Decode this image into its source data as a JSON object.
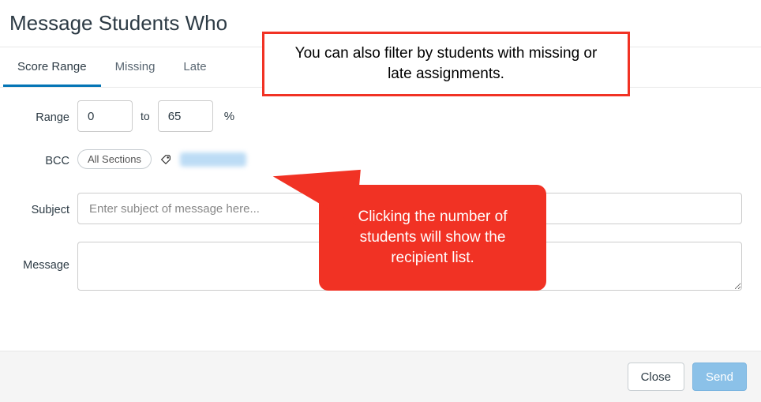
{
  "header": {
    "title": "Message Students Who"
  },
  "tabs": [
    {
      "label": "Score Range",
      "active": true
    },
    {
      "label": "Missing",
      "active": false
    },
    {
      "label": "Late",
      "active": false
    }
  ],
  "form": {
    "range_label": "Range",
    "range_from": "0",
    "range_to_word": "to",
    "range_to": "65",
    "range_unit": "%",
    "bcc_label": "BCC",
    "bcc_chip": "All Sections",
    "subject_label": "Subject",
    "subject_placeholder": "Enter subject of message here...",
    "message_label": "Message"
  },
  "footer": {
    "close": "Close",
    "send": "Send"
  },
  "annotations": {
    "top": "You can also filter by students with missing or late assignments.",
    "recipient": "Clicking the number of students will show the recipient list."
  }
}
